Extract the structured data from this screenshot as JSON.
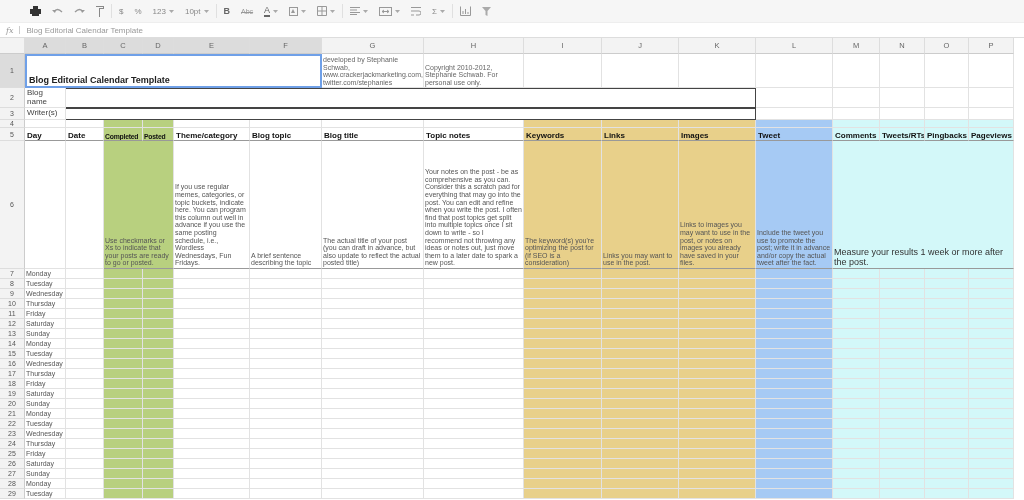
{
  "toolbar": [
    {
      "kind": "print",
      "dropdown": false
    },
    {
      "kind": "undo",
      "dropdown": false
    },
    {
      "kind": "redo",
      "dropdown": false
    },
    {
      "kind": "paint",
      "dropdown": false
    },
    {
      "kind": "text",
      "label": "$",
      "dropdown": false
    },
    {
      "kind": "text",
      "label": "%",
      "dropdown": false
    },
    {
      "kind": "text",
      "label": "123",
      "dropdown": true
    },
    {
      "kind": "text",
      "label": "10pt",
      "dropdown": true
    },
    {
      "kind": "bold",
      "label": "B",
      "dropdown": false
    },
    {
      "kind": "strike",
      "label": "Abc",
      "dropdown": false
    },
    {
      "kind": "color",
      "label": "A",
      "dropdown": true
    },
    {
      "kind": "fill",
      "dropdown": true
    },
    {
      "kind": "borders",
      "dropdown": true
    },
    {
      "kind": "align",
      "dropdown": true
    },
    {
      "kind": "merge",
      "dropdown": true
    },
    {
      "kind": "wrap",
      "dropdown": false
    },
    {
      "kind": "text",
      "label": "Σ",
      "dropdown": true
    },
    {
      "kind": "chart",
      "dropdown": false
    },
    {
      "kind": "filter",
      "dropdown": false
    }
  ],
  "formula_bar": {
    "label": "fx",
    "value": "Blog Editorial Calendar Template"
  },
  "sheet": {
    "columns": [
      {
        "label": "A",
        "selected": true
      },
      {
        "label": "B",
        "selected": true
      },
      {
        "label": "C",
        "selected": true,
        "color": "#b8d07f"
      },
      {
        "label": "D",
        "selected": true,
        "color": "#b8d07f"
      },
      {
        "label": "E",
        "selected": true
      },
      {
        "label": "F",
        "selected": true
      },
      {
        "label": "G",
        "selected": false
      },
      {
        "label": "H",
        "selected": false
      },
      {
        "label": "I",
        "selected": false,
        "color": "#e8d08a"
      },
      {
        "label": "J",
        "selected": false,
        "color": "#e8d08a"
      },
      {
        "label": "K",
        "selected": false,
        "color": "#e8d08a"
      },
      {
        "label": "L",
        "selected": false,
        "color": "#a6caf4"
      },
      {
        "label": "M",
        "selected": false,
        "color": "#d3f8f9"
      },
      {
        "label": "N",
        "selected": false,
        "color": "#d3f8f9"
      },
      {
        "label": "O",
        "selected": false,
        "color": "#d3f8f9"
      },
      {
        "label": "P",
        "selected": false,
        "color": "#d3f8f9"
      }
    ],
    "title_row": {
      "number": "1",
      "selected": true,
      "title": "Blog Editorial Calendar Template",
      "credit": "developed by Stephanie Schwab, www.crackerjackmarketing.com, twitter.com/stephanies",
      "copyright": "Copyright 2010-2012, Stephanie Schwab. For personal use only."
    },
    "info_rows": [
      {
        "number": "2",
        "label": "Blog name"
      },
      {
        "number": "3",
        "label": "Writer(s)"
      }
    ],
    "spacer_row": {
      "number": "4"
    },
    "header_row": {
      "number": "5",
      "headings": [
        "Day",
        "Date",
        "Completed",
        "Posted",
        "Theme/category",
        "Blog topic",
        "Blog title",
        "Topic notes",
        "Keywords",
        "Links",
        "Images",
        "Tweet",
        "Comments",
        "Tweets/RTs",
        "Pingbacks",
        "Pageviews"
      ]
    },
    "guide_row": {
      "number": "6",
      "notes": [
        "Use checkmarks or Xs to indicate that your posts are ready to go or posted.",
        "If you use regular memes, categories, or topic buckets, indicate here. You can program this column out well in advance if you use the same posting schedule, i.e., Wordless Wednesdays, Fun Fridays.",
        "A brief sentence describing the topic",
        "The actual title of your post (you can draft in advance, but also update to reflect the actual posted title)",
        "Your notes on the post - be as comprehensive as you can. Consider this a scratch pad for everything that may go into the post. You can edit and refine when you write the post. I often find that post topics get split into multiple topics once I sit down to write - so I recommend not throwing any ideas or notes out, just move them to a later date to spark a new post.",
        "The keyword(s) you're optimizing the post for (if SEO is a consideration)",
        "Links you may want to use in the post.",
        "Links to images you may want to use in the post, or notes on images you already have saved in your files.",
        "Include the tweet you use to promote the post; write it in advance and/or copy the actual tweet after the fact.",
        "Measure your results 1 week or more after the post."
      ]
    },
    "day_rows": [
      {
        "number": "7",
        "day": "Monday"
      },
      {
        "number": "8",
        "day": "Tuesday"
      },
      {
        "number": "9",
        "day": "Wednesday"
      },
      {
        "number": "10",
        "day": "Thursday"
      },
      {
        "number": "11",
        "day": "Friday"
      },
      {
        "number": "12",
        "day": "Saturday"
      },
      {
        "number": "13",
        "day": "Sunday"
      },
      {
        "number": "14",
        "day": "Monday"
      },
      {
        "number": "15",
        "day": "Tuesday"
      },
      {
        "number": "16",
        "day": "Wednesday"
      },
      {
        "number": "17",
        "day": "Thursday"
      },
      {
        "number": "18",
        "day": "Friday"
      },
      {
        "number": "19",
        "day": "Saturday"
      },
      {
        "number": "20",
        "day": "Sunday"
      },
      {
        "number": "21",
        "day": "Monday"
      },
      {
        "number": "22",
        "day": "Tuesday"
      },
      {
        "number": "23",
        "day": "Wednesday"
      },
      {
        "number": "24",
        "day": "Thursday"
      },
      {
        "number": "25",
        "day": "Friday"
      },
      {
        "number": "26",
        "day": "Saturday"
      },
      {
        "number": "27",
        "day": "Sunday"
      },
      {
        "number": "28",
        "day": "Monday"
      },
      {
        "number": "29",
        "day": "Tuesday"
      }
    ]
  }
}
